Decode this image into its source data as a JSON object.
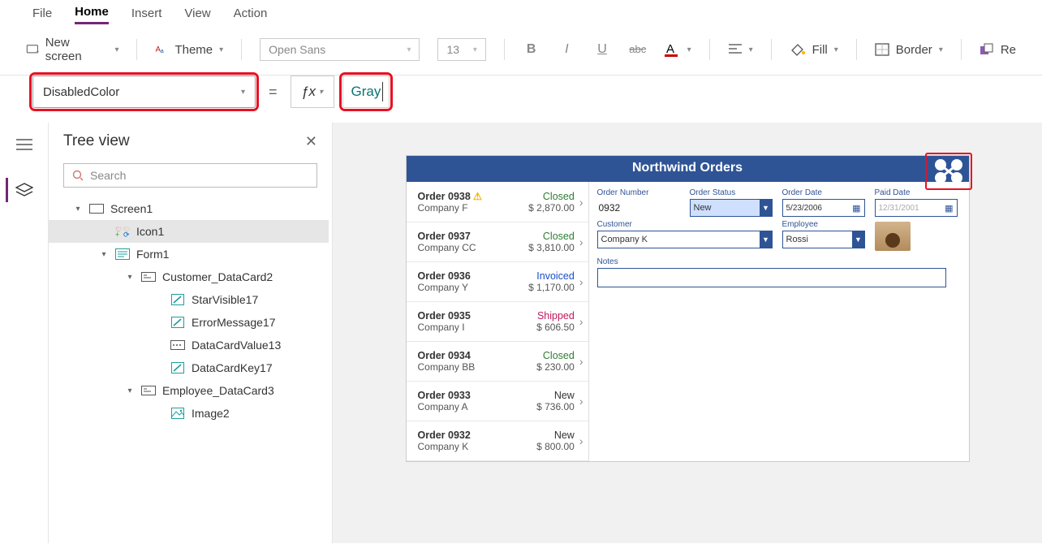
{
  "menu": {
    "file": "File",
    "home": "Home",
    "insert": "Insert",
    "view": "View",
    "action": "Action"
  },
  "ribbon": {
    "new_screen": "New screen",
    "theme": "Theme",
    "font": "Open Sans",
    "font_size": "13",
    "bold": "B",
    "italic": "I",
    "underline": "U",
    "fill": "Fill",
    "border": "Border",
    "reorder": "Re"
  },
  "formula": {
    "property": "DisabledColor",
    "value": "Gray"
  },
  "tree": {
    "title": "Tree view",
    "search_placeholder": "Search",
    "nodes": {
      "screen1": "Screen1",
      "icon1": "Icon1",
      "form1": "Form1",
      "cust_card": "Customer_DataCard2",
      "star_visible": "StarVisible17",
      "error_msg": "ErrorMessage17",
      "dcv": "DataCardValue13",
      "dck": "DataCardKey17",
      "emp_card": "Employee_DataCard3",
      "image2": "Image2"
    }
  },
  "app": {
    "title": "Northwind Orders",
    "orders": [
      {
        "id": "Order 0938",
        "warn": "⚠",
        "company": "Company F",
        "status": "Closed",
        "status_cls": "closed",
        "amount": "$ 2,870.00"
      },
      {
        "id": "Order 0937",
        "company": "Company CC",
        "status": "Closed",
        "status_cls": "closed",
        "amount": "$ 3,810.00"
      },
      {
        "id": "Order 0936",
        "company": "Company Y",
        "status": "Invoiced",
        "status_cls": "invoiced",
        "amount": "$ 1,170.00"
      },
      {
        "id": "Order 0935",
        "company": "Company I",
        "status": "Shipped",
        "status_cls": "shipped",
        "amount": "$ 606.50"
      },
      {
        "id": "Order 0934",
        "company": "Company BB",
        "status": "Closed",
        "status_cls": "closed",
        "amount": "$ 230.00"
      },
      {
        "id": "Order 0933",
        "company": "Company A",
        "status": "New",
        "status_cls": "new",
        "amount": "$ 736.00"
      },
      {
        "id": "Order 0932",
        "company": "Company K",
        "status": "New",
        "status_cls": "new",
        "amount": "$ 800.00"
      }
    ],
    "detail": {
      "labels": {
        "order_number": "Order Number",
        "order_status": "Order Status",
        "order_date": "Order Date",
        "paid_date": "Paid Date",
        "customer": "Customer",
        "employee": "Employee",
        "notes": "Notes"
      },
      "order_number": "0932",
      "order_status": "New",
      "order_date": "5/23/2006",
      "paid_date": "12/31/2001",
      "customer": "Company K",
      "employee": "Rossi"
    }
  }
}
